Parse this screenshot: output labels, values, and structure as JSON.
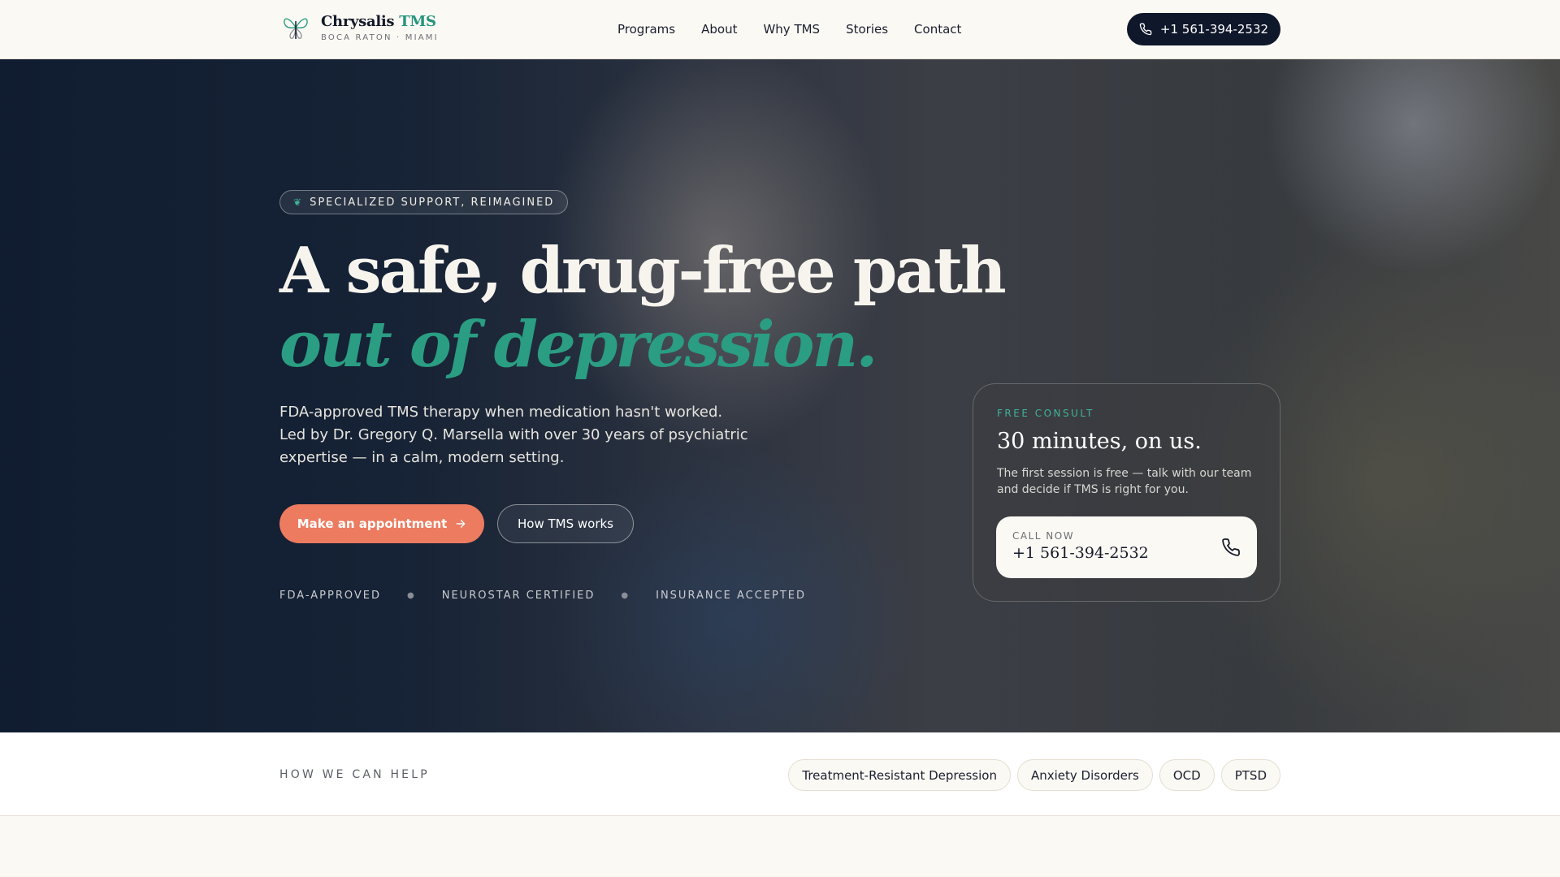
{
  "header": {
    "brand_main": "Chrysalis",
    "brand_accent": "TMS",
    "brand_sub": "BOCA RATON · MIAMI",
    "nav": [
      "Programs",
      "About",
      "Why TMS",
      "Stories",
      "Contact"
    ],
    "phone": "+1 561-394-2532"
  },
  "hero": {
    "badge": "SPECIALIZED SUPPORT, REIMAGINED",
    "title_line1": "A safe, drug-free path",
    "title_line2": "out of depression.",
    "lead": "FDA-approved TMS therapy when medication hasn't worked. Led by Dr. Gregory Q. Marsella with over 30 years of psychiatric expertise — in a calm, modern setting.",
    "primary_cta": "Make an appointment",
    "secondary_cta": "How TMS works",
    "trust": [
      "FDA-APPROVED",
      "NEUROSTAR CERTIFIED",
      "INSURANCE ACCEPTED"
    ]
  },
  "consult": {
    "kicker": "FREE CONSULT",
    "title": "30 minutes, on us.",
    "text": "The first session is free — talk with our team and decide if TMS is right for you.",
    "call_label": "CALL NOW",
    "call_number": "+1 561-394-2532"
  },
  "help": {
    "label": "HOW WE CAN HELP",
    "chips": [
      "Treatment-Resistant Depression",
      "Anxiety Disorders",
      "OCD",
      "PTSD"
    ]
  },
  "colors": {
    "accent_green": "#2a9d82",
    "cta_coral": "#ec7b5f",
    "navy": "#0f172a",
    "cream": "#fbf9f4"
  }
}
